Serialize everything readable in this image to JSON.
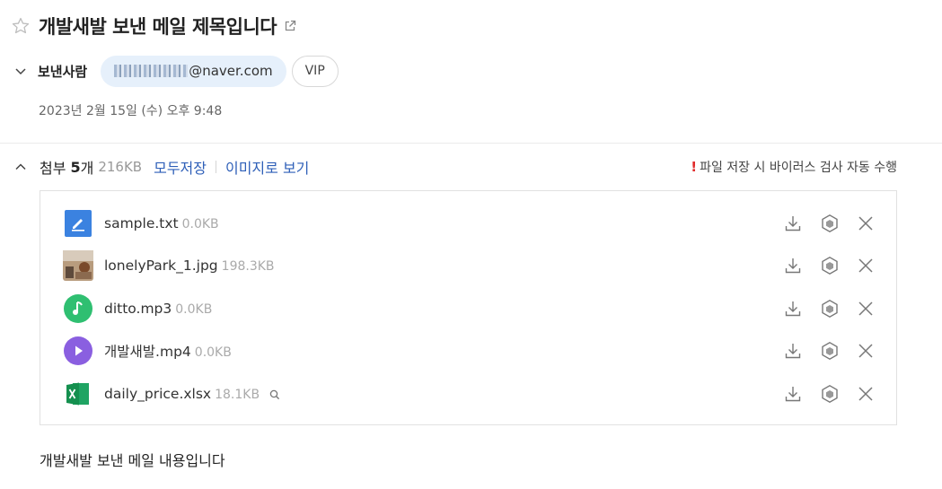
{
  "mail": {
    "title": "개발새발 보낸 메일 제목입니다",
    "sender_label": "보낸사람",
    "sender_email_visible": "@naver.com",
    "vip_label": "VIP",
    "date": "2023년 2월 15일 (수) 오후 9:48",
    "body": "개발새발 보낸 메일 내용입니다"
  },
  "attachments": {
    "label": "첨부",
    "count": "5",
    "unit": "개",
    "total_size": "216KB",
    "save_all": "모두저장",
    "view_images": "이미지로 보기",
    "notice_mark": "!",
    "notice": "파일 저장 시 바이러스 검사 자동 수행",
    "files": [
      {
        "name": "sample.txt",
        "size": "0.0KB",
        "icon": "text-file-icon"
      },
      {
        "name": "lonelyPark_1.jpg",
        "size": "198.3KB",
        "icon": "image-thumbnail"
      },
      {
        "name": "ditto.mp3",
        "size": "0.0KB",
        "icon": "music-file-icon"
      },
      {
        "name": "개발새발.mp4",
        "size": "0.0KB",
        "icon": "video-file-icon"
      },
      {
        "name": "daily_price.xlsx",
        "size": "18.1KB",
        "icon": "excel-file-icon"
      }
    ]
  },
  "colors": {
    "link": "#2e5fb8",
    "chip_bg": "#e6f0fb",
    "txt_icon": "#3b82e0",
    "mp3_icon": "#2fbf71",
    "mp4_icon": "#8a5fe0",
    "xlsx_icon": "#1fa463",
    "notice_mark": "#e02b2b"
  }
}
